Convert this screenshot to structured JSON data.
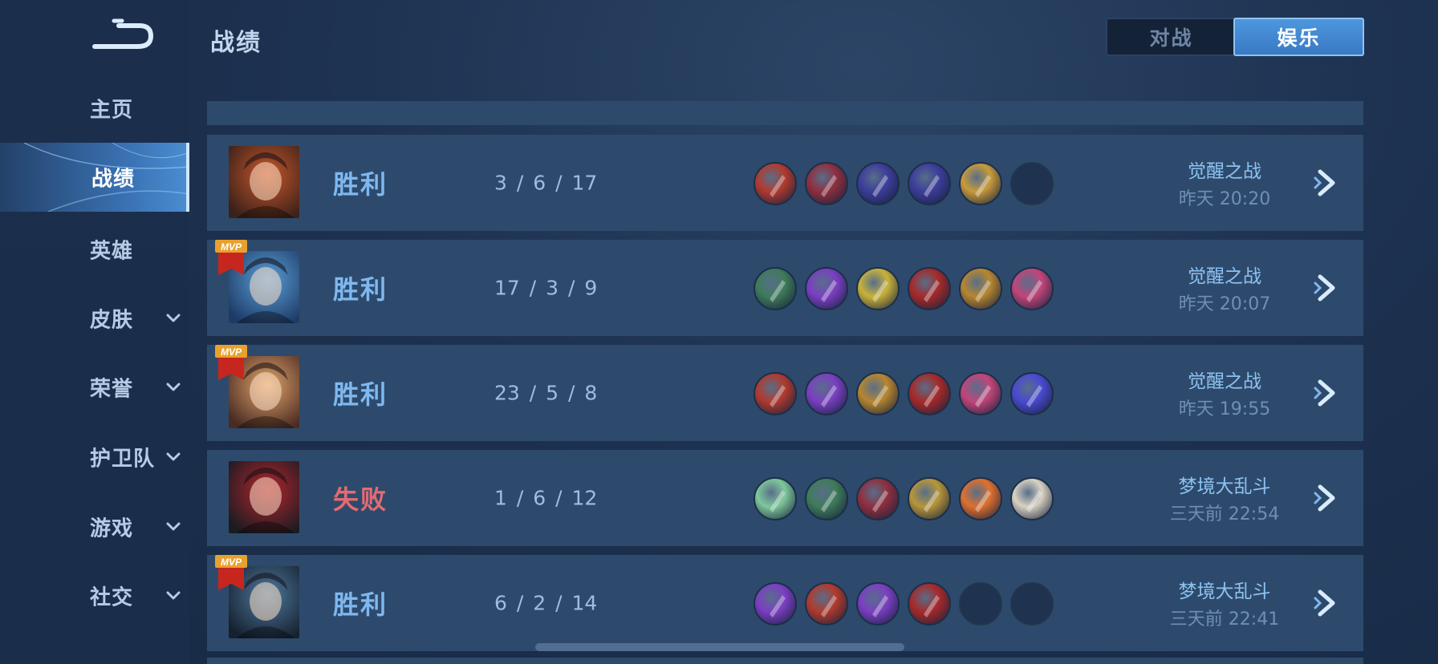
{
  "sidebar": {
    "items": [
      {
        "label": "主页",
        "chevron": false,
        "active": false
      },
      {
        "label": "战绩",
        "chevron": false,
        "active": true
      },
      {
        "label": "英雄",
        "chevron": false,
        "active": false
      },
      {
        "label": "皮肤",
        "chevron": true,
        "active": false
      },
      {
        "label": "荣誉",
        "chevron": true,
        "active": false
      },
      {
        "label": "护卫队",
        "chevron": true,
        "active": false
      },
      {
        "label": "游戏",
        "chevron": true,
        "active": false
      },
      {
        "label": "社交",
        "chevron": true,
        "active": false
      }
    ]
  },
  "header": {
    "title": "战绩",
    "tabs": [
      {
        "label": "对战",
        "active": false
      },
      {
        "label": "娱乐",
        "active": true
      }
    ]
  },
  "colors": {
    "win": "#7fb8f0",
    "lose": "#e46a73",
    "accent": "#4a8ed2",
    "row_bg": "#2d4a6c"
  },
  "matches": [
    {
      "result": "胜利",
      "outcome": "win",
      "mvp": false,
      "kda": "3 / 6 / 17",
      "mode": "觉醒之战",
      "time": "昨天 20:20",
      "avatar_colors": [
        "#c9572d",
        "#3a2119"
      ],
      "items": [
        "#b23a2e",
        "#8f2f3f",
        "#3d3d9a",
        "#3d3d9a",
        "#c99a3a",
        null
      ]
    },
    {
      "result": "胜利",
      "outcome": "win",
      "mvp": true,
      "kda": "17 / 3 / 9",
      "mode": "觉醒之战",
      "time": "昨天 20:07",
      "avatar_colors": [
        "#5aa0d8",
        "#1e3a66"
      ],
      "items": [
        "#3f7b5a",
        "#7b3fc2",
        "#c9b23a",
        "#a62a2a",
        "#b8862f",
        "#c2457a"
      ]
    },
    {
      "result": "胜利",
      "outcome": "win",
      "mvp": true,
      "kda": "23 / 5 / 8",
      "mode": "觉醒之战",
      "time": "昨天 19:55",
      "avatar_colors": [
        "#e0a56b",
        "#4a2a22"
      ],
      "items": [
        "#b23a2e",
        "#7b3fc2",
        "#b8862f",
        "#a62a2a",
        "#c2457a",
        "#4a4ad0"
      ]
    },
    {
      "result": "失败",
      "outcome": "lose",
      "mvp": false,
      "kda": "1 / 6 / 12",
      "mode": "梦境大乱斗",
      "time": "三天前 22:54",
      "avatar_colors": [
        "#b3262c",
        "#1b1b22"
      ],
      "items": [
        "#7fc79a",
        "#3f7b5a",
        "#8f2f3f",
        "#b8963a",
        "#e0702e",
        "#d9d2c2"
      ]
    },
    {
      "result": "胜利",
      "outcome": "win",
      "mvp": true,
      "kda": "6 / 2 / 14",
      "mode": "梦境大乱斗",
      "time": "三天前 22:41",
      "avatar_colors": [
        "#4f7aa0",
        "#16202e"
      ],
      "items": [
        "#7b3fc2",
        "#b23a2e",
        "#7b3fc2",
        "#a62a2a",
        null,
        null
      ]
    }
  ]
}
